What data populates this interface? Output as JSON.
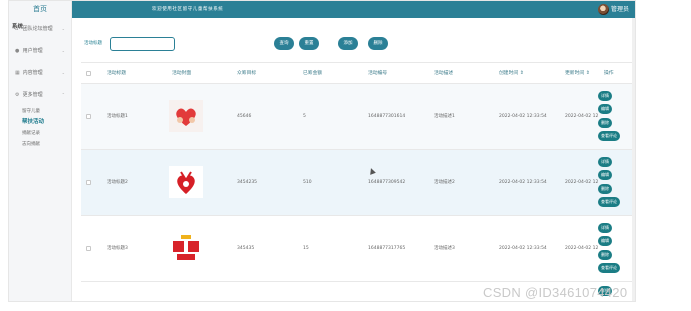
{
  "header": {
    "title": "欢迎使用社区留守儿童帮扶系统",
    "user": "管理员"
  },
  "sidebar": {
    "brand": "首页",
    "items": [
      {
        "label": "团队论坛管理",
        "overlay": "系统",
        "icon": "home-icon"
      },
      {
        "label": "用户管理",
        "icon": "user-icon"
      },
      {
        "label": "内容管理",
        "icon": "grid-icon"
      },
      {
        "label": "更多管理",
        "icon": "gear-icon"
      }
    ],
    "subitems": [
      {
        "label": "留守儿童"
      },
      {
        "label": "帮扶活动",
        "active": true
      },
      {
        "label": "捐献记录"
      },
      {
        "label": "志向捐献"
      }
    ]
  },
  "toolbar": {
    "search_label": "活动标题",
    "search_value": "",
    "query": "查询",
    "reset": "重置",
    "add": "添加",
    "delete": "删除"
  },
  "table": {
    "columns": [
      "活动标题",
      "活动封面",
      "众筹目标",
      "已筹金额",
      "活动编号",
      "活动描述",
      "创建时间 ⇕",
      "更新时间 ⇕",
      "操作"
    ],
    "rows": [
      {
        "title": "活动标题1",
        "target": "45646",
        "raised": "5",
        "code": "1648877301614",
        "desc": "活动描述1",
        "created": "2022-04-02 12:33:54",
        "updated": "2022-04-02 12"
      },
      {
        "title": "活动标题2",
        "target": "3454235",
        "raised": "510",
        "code": "1648877309542",
        "desc": "活动描述2",
        "created": "2022-04-02 12:33:54",
        "updated": "2022-04-02 12"
      },
      {
        "title": "活动标题3",
        "target": "345435",
        "raised": "15",
        "code": "1648877317765",
        "desc": "活动描述3",
        "created": "2022-04-02 12:33:54",
        "updated": "2022-04-02 12"
      }
    ],
    "actions": [
      "详情",
      "编辑",
      "删除",
      "查看评论"
    ]
  },
  "watermark": "CSDN @ID3461074420"
}
